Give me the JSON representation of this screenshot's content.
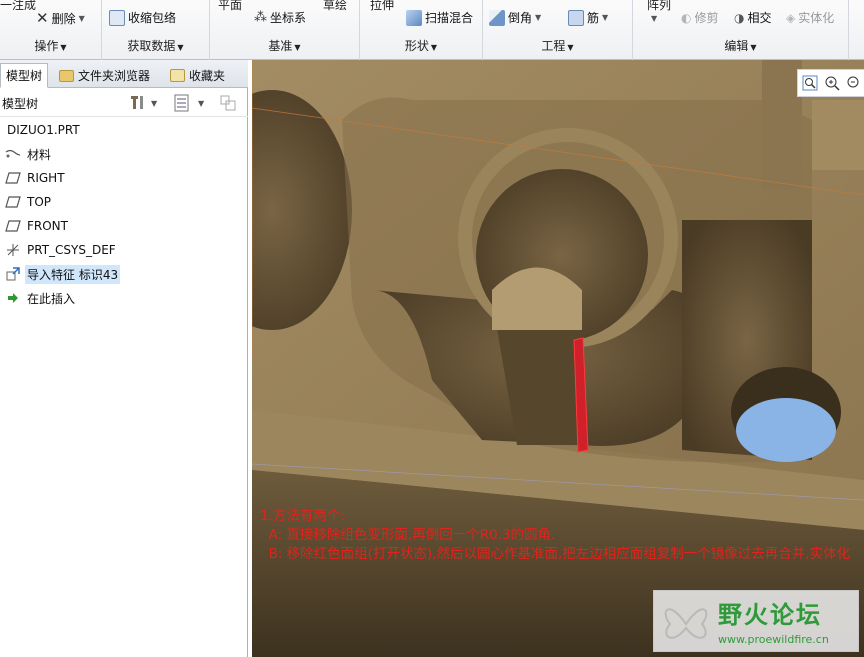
{
  "ribbon": {
    "groups": [
      {
        "label": "操作",
        "cut_top": "一注成",
        "buttons": [
          "删除"
        ]
      },
      {
        "label": "获取数据",
        "buttons": [
          "收缩包络"
        ]
      },
      {
        "label": "基准",
        "cut_top": "平面",
        "cut_top2": "草绘",
        "buttons": [
          "坐标系"
        ]
      },
      {
        "label": "形状",
        "cut_top": "拉伸",
        "buttons": [
          "扫描混合"
        ]
      },
      {
        "label": "工程",
        "buttons": [
          "倒角",
          "筋"
        ]
      },
      {
        "label": "编辑",
        "cut_top": "阵列",
        "buttons": [
          "修剪",
          "相交",
          "实体化"
        ]
      }
    ]
  },
  "panel": {
    "tabs": [
      "模型树",
      "文件夹浏览器",
      "收藏夹"
    ],
    "tree_title": "模型树",
    "nodes": [
      {
        "label": "DIZUO1.PRT",
        "icon": "none"
      },
      {
        "label": "材料",
        "icon": "material-icon"
      },
      {
        "label": "RIGHT",
        "icon": "datum-plane-icon"
      },
      {
        "label": "TOP",
        "icon": "datum-plane-icon"
      },
      {
        "label": "FRONT",
        "icon": "datum-plane-icon"
      },
      {
        "label": "PRT_CSYS_DEF",
        "icon": "csys-icon"
      },
      {
        "label": "导入特征 标识43",
        "icon": "import-feature-icon",
        "selected": true
      },
      {
        "label": "在此插入",
        "icon": "insert-here-arrow-icon"
      }
    ]
  },
  "viewport": {
    "notes": [
      "1.方法有两个:",
      "  A: 直接移除组色变形面,再倒回一个R0.3的圆角.",
      "  B: 移除红色面组(打开状态),然后以圆心作基准面,把左边相应面组复制一个镜像过去再合并,实体化"
    ],
    "watermark": {
      "title": "野火论坛",
      "url": "www.proewildfire.cn"
    }
  },
  "colors": {
    "model": "#a08a62",
    "model_dark": "#4e3f28",
    "hole_blue": "#8ab4e6",
    "note_red": "#e0241c",
    "highlight_red": "#d0202a"
  }
}
